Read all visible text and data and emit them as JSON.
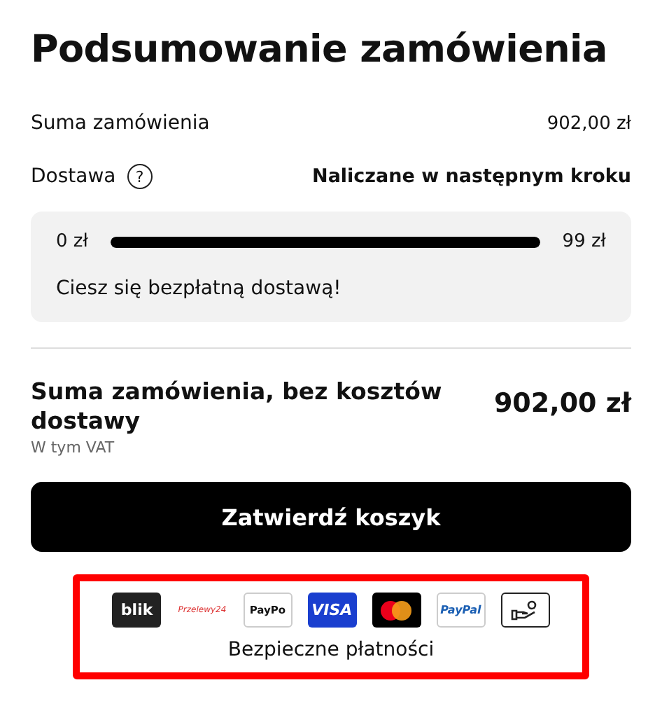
{
  "title": "Podsumowanie zamówienia",
  "summary_rows": [
    {
      "label": "Suma zamówienia",
      "value": "902,00 zł",
      "kind": "plain"
    },
    {
      "label": "Dostawa",
      "value": "Naliczane w następnym kroku",
      "kind": "help"
    }
  ],
  "help_icon": "?",
  "free_delivery": {
    "min_label": "0 zł",
    "max_label": "99 zł",
    "level": 1,
    "message": "Ciesz się bezpłatną dostawą!"
  },
  "total": {
    "label": "Suma zamówienia, bez kosztów dostawy",
    "value": "902,00 zł",
    "note": "W tym VAT"
  },
  "confirm_button": "Zatwierdź koszyk",
  "payments": {
    "highlighted": true,
    "methods": [
      {
        "kind": "blik",
        "label": "blik"
      },
      {
        "kind": "przelewy",
        "label": "Przelewy24"
      },
      {
        "kind": "paypo",
        "label": "PayPo"
      },
      {
        "kind": "visa",
        "label": "VISA"
      },
      {
        "kind": "mastercard"
      },
      {
        "kind": "paypal",
        "label": "PayPal"
      },
      {
        "kind": "cash"
      }
    ],
    "caption": "Bezpieczne płatności"
  }
}
